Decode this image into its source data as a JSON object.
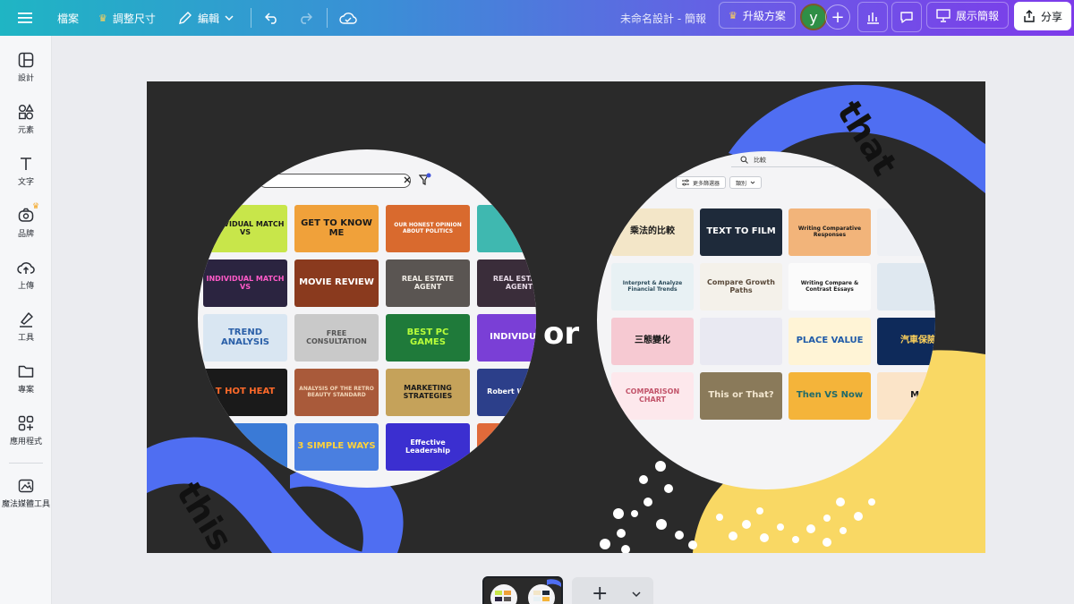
{
  "topbar": {
    "file_label": "檔案",
    "resize_label": "調整尺寸",
    "edit_label": "編輯",
    "doc_title": "未命名設計 - 簡報",
    "upgrade_label": "升級方案",
    "avatar_letter": "y",
    "present_label": "展示簡報",
    "share_label": "分享"
  },
  "sidebar": {
    "items": [
      {
        "label": "設計",
        "icon": "layout-icon"
      },
      {
        "label": "元素",
        "icon": "shapes-icon"
      },
      {
        "label": "文字",
        "icon": "text-icon"
      },
      {
        "label": "品牌",
        "icon": "brand-icon"
      },
      {
        "label": "上傳",
        "icon": "upload-cloud-icon"
      },
      {
        "label": "工具",
        "icon": "pen-tool-icon"
      },
      {
        "label": "專案",
        "icon": "folder-icon"
      },
      {
        "label": "應用程式",
        "icon": "apps-icon"
      },
      {
        "label": "魔法媒體工具",
        "icon": "magic-media-icon"
      }
    ]
  },
  "canvas": {
    "word_or": "or",
    "word_this": "this",
    "word_that": "that",
    "left_panel": {
      "templates": [
        {
          "text": "INDIVIDUAL MATCH VS",
          "bg": "#c8e64a",
          "fg": "#1a1a1a"
        },
        {
          "text": "GET TO KNOW ME",
          "bg": "#f0a13a",
          "fg": "#1a1a1a"
        },
        {
          "text": "OUR HONEST OPINION ABOUT POLITICS",
          "bg": "#d96a2e",
          "fg": "#ffffff"
        },
        {
          "text": "",
          "bg": "#3fb8b0",
          "fg": "#ffffff"
        },
        {
          "text": "INDIVIDUAL MATCH VS",
          "bg": "#2b2440",
          "fg": "#ff5ac8"
        },
        {
          "text": "MOVIE REVIEW",
          "bg": "#8a3a1e",
          "fg": "#ffffff"
        },
        {
          "text": "REAL ESTATE AGENT",
          "bg": "#5a5552",
          "fg": "#f1ede6"
        },
        {
          "text": "REAL ESTATE AGENT",
          "bg": "#3a2d3a",
          "fg": "#e6d9e6"
        },
        {
          "text": "TREND ANALYSIS",
          "bg": "#d9e6f2",
          "fg": "#2a5fa8"
        },
        {
          "text": "FREE CONSULTATION",
          "bg": "#c9c9c9",
          "fg": "#555555"
        },
        {
          "text": "BEST PC GAMES",
          "bg": "#1f7a3a",
          "fg": "#b8ff3a"
        },
        {
          "text": "INDIVIDUAL",
          "bg": "#7a3fd6",
          "fg": "#ffffff"
        },
        {
          "text": "T HOT HEAT",
          "bg": "#1a1a1a",
          "fg": "#ff6a2a"
        },
        {
          "text": "ANALYSIS OF THE RETRO BEAUTY STANDARD",
          "bg": "#a95a3a",
          "fg": "#f3d6b8"
        },
        {
          "text": "MARKETING STRATEGIES",
          "bg": "#c5a25a",
          "fg": "#1a1a1a"
        },
        {
          "text": "Robert Williams",
          "bg": "#2c3f8a",
          "fg": "#ffffff"
        },
        {
          "text": "",
          "bg": "#3a7ad6",
          "fg": "#ffffff"
        },
        {
          "text": "3 SIMPLE WAYS",
          "bg": "#4a7fe0",
          "fg": "#ffd23a"
        },
        {
          "text": "Effective Leadership",
          "bg": "#3b2fd0",
          "fg": "#ffffff"
        },
        {
          "text": "",
          "bg": "#e06a3a",
          "fg": "#ffffff"
        }
      ]
    },
    "right_panel": {
      "search_text": "比較",
      "filter_button_label": "更多篩選器",
      "category_label": "類別",
      "templates": [
        {
          "text": "乘法的比較",
          "bg": "#f3e6c8",
          "fg": "#1a1a1a"
        },
        {
          "text": "TEXT TO FILM",
          "bg": "#1e2a3a",
          "fg": "#ffffff"
        },
        {
          "text": "Writing Comparative Responses",
          "bg": "#f2b47a",
          "fg": "#1a1a1a"
        },
        {
          "text": "",
          "bg": "#eef0f4",
          "fg": "#1a1a1a"
        },
        {
          "text": "Interpret & Analyze Financial Trends",
          "bg": "#e8f1f4",
          "fg": "#2a4a5a"
        },
        {
          "text": "Compare Growth Paths",
          "bg": "#f4f1ea",
          "fg": "#5a4a3a"
        },
        {
          "text": "Writing Compare & Contrast Essays",
          "bg": "#fbfbfb",
          "fg": "#1a1a1a"
        },
        {
          "text": "",
          "bg": "#dfe8f0",
          "fg": "#1a1a1a"
        },
        {
          "text": "三態變化",
          "bg": "#f6c9d2",
          "fg": "#1a1a1a"
        },
        {
          "text": "",
          "bg": "#e9e9f2",
          "fg": "#1a1a1a"
        },
        {
          "text": "PLACE VALUE",
          "bg": "#fff4d6",
          "fg": "#1f5aa8"
        },
        {
          "text": "汽車保險",
          "bg": "#0e2a5a",
          "fg": "#ffd25a"
        },
        {
          "text": "COMPARISON CHART",
          "bg": "#fde8ec",
          "fg": "#c2546a"
        },
        {
          "text": "This or That?",
          "bg": "#8a7a5a",
          "fg": "#f2e6cf"
        },
        {
          "text": "Then VS Now",
          "bg": "#f4b43a",
          "fg": "#1f6a6a"
        },
        {
          "text": "MA",
          "bg": "#fbe4c8",
          "fg": "#1a1a1a"
        }
      ]
    }
  },
  "pages": {
    "add_page_label": "+"
  },
  "colors": {
    "blob_blue": "#4f6ef2",
    "blob_yellow": "#f9d864",
    "canvas_bg": "#2a2a2a",
    "brand_gradient_start": "#1fb5c4",
    "brand_gradient_end": "#7d3bea"
  }
}
